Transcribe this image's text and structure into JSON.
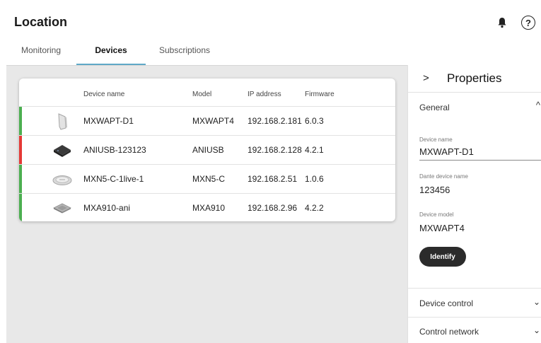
{
  "header": {
    "title": "Location",
    "icons": [
      "bell-icon",
      "help-icon"
    ],
    "help_glyph": "?"
  },
  "tabs": [
    {
      "label": "Monitoring"
    },
    {
      "label": "Devices",
      "active": true
    },
    {
      "label": "Subscriptions"
    }
  ],
  "table": {
    "columns": [
      "Device name",
      "Model",
      "IP address",
      "Firmware"
    ],
    "rows": [
      {
        "name": "MXWAPT-D1",
        "model": "MXWAPT4",
        "ip": "192.168.2.181",
        "firmware": "6.0.3",
        "status_color": "#4caf50",
        "icon": "access-point-device-icon"
      },
      {
        "name": "ANIUSB-123123",
        "model": "ANIUSB",
        "ip": "192.168.2.128",
        "firmware": "4.2.1",
        "status_color": "#e53935",
        "icon": "usb-interface-device-icon"
      },
      {
        "name": "MXN5-C-1live-1",
        "model": "MXN5-C",
        "ip": "192.168.2.51",
        "firmware": "1.0.6",
        "status_color": "#4caf50",
        "icon": "ceiling-speaker-device-icon"
      },
      {
        "name": "MXA910-ani",
        "model": "MXA910",
        "ip": "192.168.2.96",
        "firmware": "4.2.2",
        "status_color": "#4caf50",
        "icon": "array-microphone-device-icon"
      }
    ]
  },
  "properties": {
    "title": "Properties",
    "collapse_glyph": ">",
    "general": {
      "label": "General",
      "expand_glyph": "^",
      "device_name_label": "Device name",
      "device_name_value": "MXWAPT-D1",
      "dante_label": "Dante device name",
      "dante_value": "123456",
      "model_label": "Device model",
      "model_value": "MXWAPT4",
      "identify_label": "Identify"
    },
    "sections": [
      {
        "label": "Device control",
        "glyph": "⌄"
      },
      {
        "label": "Control network",
        "glyph": "⌄"
      }
    ]
  },
  "colors": {
    "accent": "#5fa8c7",
    "status_ok": "#4caf50",
    "status_error": "#e53935",
    "background": "#e8e8e8"
  }
}
